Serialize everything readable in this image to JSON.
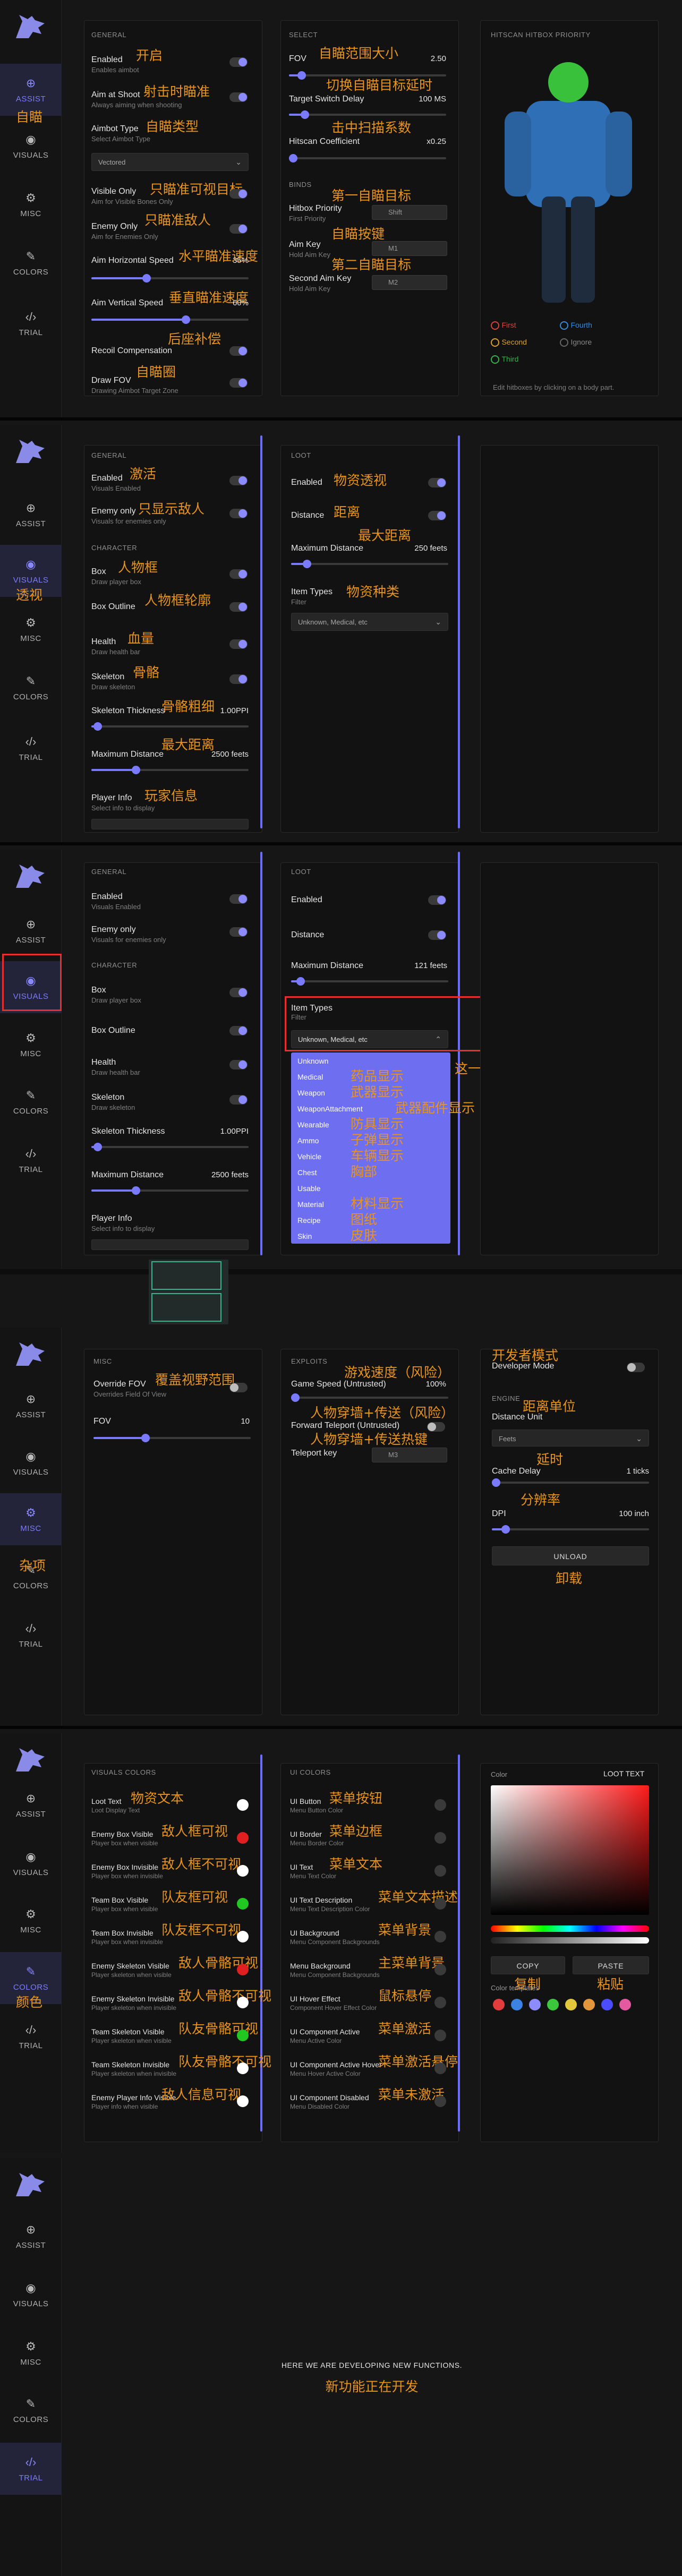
{
  "nav": {
    "assist": "ASSIST",
    "visuals": "VISUALS",
    "misc": "MISC",
    "colors": "COLORS",
    "trial": "TRIAL"
  },
  "nav_cn": {
    "assist": "自瞄",
    "visuals": "透视",
    "misc": "杂项",
    "colors": "颜色"
  },
  "icons": [
    "wolf-logo-icon",
    "crosshair-icon",
    "eye-icon",
    "gear-icon",
    "brush-icon",
    "code-icon"
  ],
  "s1": {
    "general_h": "GENERAL",
    "enabled": "Enabled",
    "enabled_sub": "Enables aimbot",
    "enabled_cn": "开启",
    "aim_shoot": "Aim at Shoot",
    "aim_shoot_sub": "Always aiming when shooting",
    "aim_shoot_cn": "射击时瞄准",
    "aimbot_type": "Aimbot Type",
    "aimbot_type_sub": "Select Aimbot Type",
    "aimbot_type_cn": "自瞄类型",
    "aimbot_type_val": "Vectored",
    "visible_only": "Visible Only",
    "visible_only_sub": "Aim for Visible Bones Only",
    "visible_only_cn": "只瞄准可视目标",
    "enemy_only": "Enemy Only",
    "enemy_only_sub": "Aim for Enemies Only",
    "enemy_only_cn": "只瞄准敌人",
    "h_speed": "Aim Horizontal Speed",
    "h_speed_val": "35%",
    "h_speed_cn": "水平瞄准速度",
    "h_speed_pct": 0.35,
    "v_speed": "Aim Vertical Speed",
    "v_speed_val": "60%",
    "v_speed_cn": "垂直瞄准速度",
    "v_speed_pct": 0.6,
    "recoil_cn": "后座补偿",
    "recoil": "Recoil Compensation",
    "draw_fov": "Draw FOV",
    "draw_fov_sub": "Drawing Aimbot Target Zone",
    "draw_fov_cn": "自瞄圈",
    "select_h": "SELECT",
    "fov": "FOV",
    "fov_val": "2.50",
    "fov_cn": "自瞄范围大小",
    "fov_pct": 0.08,
    "switch_cn": "切换自瞄目标延时",
    "switch": "Target Switch Delay",
    "switch_val": "100 MS",
    "switch_pct": 0.1,
    "hitscan_cn": "击中扫描系数",
    "hitscan": "Hitscan Coefficient",
    "hitscan_val": "x0.25",
    "hitscan_pct": 0.02,
    "binds_h": "BINDS",
    "hb_cn": "第一自瞄目标",
    "hb": "Hitbox Priority",
    "hb_sub": "First Priority",
    "hb_key": "Shift",
    "aimkey_cn": "自瞄按键",
    "aimkey": "Aim Key",
    "aimkey_sub": "Hold Aim Key",
    "aimkey_key": "M1",
    "aimkey2_cn": "第二自瞄目标",
    "aimkey2": "Second Aim Key",
    "aimkey2_sub": "Hold Aim Key",
    "aimkey2_key": "M2",
    "hitbox_h": "HITSCAN HITBOX PRIORITY",
    "legend": [
      "First",
      "Fourth",
      "Second",
      "Ignore",
      "Third"
    ],
    "legend_colors": [
      "#d9443a",
      "#3a8ad9",
      "#d9a030",
      "#555555",
      "#3ab04a"
    ],
    "hint": "Edit hitboxes by clicking on a body part."
  },
  "s2": {
    "general_h": "GENERAL",
    "enabled": "Enabled",
    "enabled_sub": "Visuals Enabled",
    "enabled_cn": "激活",
    "enemy_only": "Enemy only",
    "enemy_only_sub": "Visuals for enemies only",
    "enemy_only_cn": "只显示敌人",
    "char_h": "CHARACTER",
    "box": "Box",
    "box_sub": "Draw player box",
    "box_cn": "人物框",
    "box_outline": "Box Outline",
    "box_outline_cn": "人物框轮廓",
    "health": "Health",
    "health_sub": "Draw health bar",
    "health_cn": "血量",
    "skeleton": "Skeleton",
    "skeleton_sub": "Draw skeleton",
    "skeleton_cn": "骨骼",
    "thick": "Skeleton Thickness",
    "thick_val": "1.00PPI",
    "thick_cn": "骨骼粗细",
    "maxd": "Maximum Distance",
    "maxd_val": "2500 feets",
    "maxd_cn": "最大距离",
    "pinfo": "Player Info",
    "pinfo_sub": "Select info to display",
    "pinfo_cn": "玩家信息",
    "loot_h": "LOOT",
    "loot_en": "Enabled",
    "loot_en_cn": "物资透视",
    "loot_dist": "Distance",
    "loot_dist_cn": "距离",
    "loot_maxd": "Maximum Distance",
    "loot_maxd_val": "250 feets",
    "loot_maxd_cn": "最大距离",
    "types": "Item Types",
    "types_sub": "Filter",
    "types_cn": "物资种类",
    "types_val": "Unknown, Medical, etc"
  },
  "s3": {
    "general_h": "GENERAL",
    "enabled": "Enabled",
    "enabled_sub": "Visuals Enabled",
    "enemy_only": "Enemy only",
    "enemy_only_sub": "Visuals for enemies only",
    "char_h": "CHARACTER",
    "box": "Box",
    "box_sub": "Draw player box",
    "box_outline": "Box Outline",
    "health": "Health",
    "health_sub": "Draw health bar",
    "skeleton": "Skeleton",
    "skeleton_sub": "Draw skeleton",
    "thick": "Skeleton Thickness",
    "thick_val": "1.00PPI",
    "maxd": "Maximum Distance",
    "maxd_val": "2500 feets",
    "pinfo": "Player Info",
    "pinfo_sub": "Select info to display",
    "loot_h": "LOOT",
    "loot_en": "Enabled",
    "loot_dist": "Distance",
    "loot_maxd": "Maximum Distance",
    "loot_maxd_val": "121 feets",
    "types": "Item Types",
    "types_sub": "Filter",
    "types_val": "Unknown, Medical, etc",
    "options": [
      "Unknown",
      "Medical",
      "Weapon",
      "WeaponAttachment",
      "Wearable",
      "Ammo",
      "Vehicle",
      "Chest",
      "Usable",
      "Material",
      "Recipe",
      "Skin"
    ],
    "options_cn": [
      "",
      "药品显示",
      "武器显示",
      "武器配件显示",
      "防具显示",
      "子弹显示",
      "车辆显示",
      "胸部",
      "",
      "材料显示",
      "图纸",
      "皮肤"
    ],
    "note_cn": "这一页是物资显示选项开关"
  },
  "s4": {
    "misc_h": "MISC",
    "ofov": "Override FOV",
    "ofov_sub": "Overrides Field Of View",
    "ofov_cn": "覆盖视野范围",
    "fov": "FOV",
    "fov_val": "10",
    "fov_pct": 0.33,
    "exp_h": "EXPLOITS",
    "gs_cn": "游戏速度（风险）",
    "gs": "Game Speed (Untrusted)",
    "gs_val": "100%",
    "ft_cn": "人物穿墙+传送（风险）",
    "ft": "Forward Teleport (Untrusted)",
    "tk_cn": "人物穿墙+传送热键",
    "tk": "Teleport key",
    "tk_key": "M3",
    "dev_cn": "开发者模式",
    "dev": "Developer Mode",
    "engine_h": "ENGINE",
    "du_cn": "距离单位",
    "du": "Distance Unit",
    "du_val": "Feets",
    "cd_cn": "延时",
    "cd": "Cache Delay",
    "cd_val": "1 ticks",
    "dpi_cn": "分辨率",
    "dpi": "DPI",
    "dpi_val": "100 inch",
    "unload": "UNLOAD",
    "unload_cn": "卸载"
  },
  "s5": {
    "vc_h": "VISUALS COLORS",
    "items": [
      {
        "l": "Loot Text",
        "s": "Loot Display Text",
        "cn": "物资文本",
        "c": "#ffffff"
      },
      {
        "l": "Enemy Box Visible",
        "s": "Player box when visible",
        "cn": "敌人框可视",
        "c": "#e02020"
      },
      {
        "l": "Enemy Box Invisible",
        "s": "Player box when invisible",
        "cn": "敌人框不可视",
        "c": "#ffffff"
      },
      {
        "l": "Team Box Visible",
        "s": "Player box when visible",
        "cn": "队友框可视",
        "c": "#21c821"
      },
      {
        "l": "Team Box Invisible",
        "s": "Player box when invisible",
        "cn": "队友框不可视",
        "c": "#ffffff"
      },
      {
        "l": "Enemy Skeleton Visible",
        "s": "Player skeleton when visible",
        "cn": "敌人骨骼可视",
        "c": "#e02020"
      },
      {
        "l": "Enemy Skeleton Invisible",
        "s": "Player skeleton when invisible",
        "cn": "敌人骨骼不可视",
        "c": "#ffffff"
      },
      {
        "l": "Team Skeleton Visible",
        "s": "Player skeleton when visible",
        "cn": "队友骨骼可视",
        "c": "#21c821"
      },
      {
        "l": "Team Skeleton Invisible",
        "s": "Player skeleton when invisible",
        "cn": "队友骨骼不可视",
        "c": "#ffffff"
      },
      {
        "l": "Enemy Player Info Visible",
        "s": "Player info when visible",
        "cn": "敌人信息可视",
        "c": "#ffffff"
      }
    ],
    "uc_h": "UI COLORS",
    "ui": [
      {
        "l": "UI Button",
        "s": "Menu Button Color",
        "cn": "菜单按钮"
      },
      {
        "l": "UI Border",
        "s": "Menu Border Color",
        "cn": "菜单边框"
      },
      {
        "l": "UI Text",
        "s": "Menu Text Color",
        "cn": "菜单文本"
      },
      {
        "l": "UI Text Description",
        "s": "Menu Text Description Color",
        "cn": "菜单文本描述"
      },
      {
        "l": "UI Background",
        "s": "Menu Component Backgrounds",
        "cn": "菜单背景"
      },
      {
        "l": "Menu Background",
        "s": "Menu Component Backgrounds",
        "cn": "主菜单背景"
      },
      {
        "l": "UI Hover Effect",
        "s": "Component Hover Effect Color",
        "cn": "鼠标悬停"
      },
      {
        "l": "UI Component Active",
        "s": "Menu Active Color",
        "cn": "菜单激活"
      },
      {
        "l": "UI Component Active Hover",
        "s": "Menu Hover Active Color",
        "cn": "菜单激活悬停"
      },
      {
        "l": "UI Component Disabled",
        "s": "Menu Disabled Color",
        "cn": "菜单未激活"
      }
    ],
    "color_h": "Color",
    "color_sel": "LOOT TEXT",
    "copy": "COPY",
    "paste": "PASTE",
    "copy_cn": "复制",
    "paste_cn": "粘贴",
    "tmpl": "Color templates",
    "tmpl_colors": [
      "#e33c3c",
      "#3c82e3",
      "#8c8cff",
      "#3cc83c",
      "#e3c83c",
      "#e3963c",
      "#4b4bff",
      "#e35aa0"
    ]
  },
  "s6": {
    "msg": "HERE WE ARE DEVELOPING NEW FUNCTIONS.",
    "msg_cn": "新功能正在开发"
  }
}
